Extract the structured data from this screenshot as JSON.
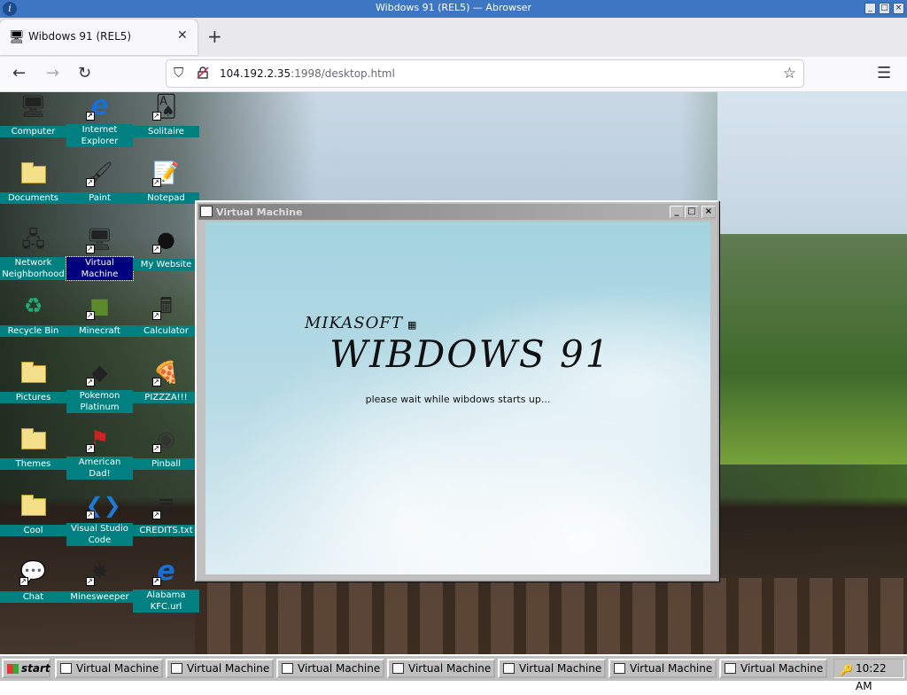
{
  "browser": {
    "window_title": "Wibdows 91 (REL5) — Abrowser",
    "tab_title": "Wibdows 91 (REL5)",
    "url_host": "104.192.2.35",
    "url_rest": ":1998/desktop.html",
    "icons": [
      "back-icon",
      "forward-icon",
      "reload-icon",
      "shield-icon",
      "lock-icon",
      "star-icon",
      "menu-icon"
    ]
  },
  "desktop": {
    "icons": [
      {
        "label": "Computer",
        "icon": "computer-icon"
      },
      {
        "label": "Internet Explorer",
        "icon": "internet-explorer-icon"
      },
      {
        "label": "Solitaire",
        "icon": "solitaire-icon"
      },
      {
        "label": "Documents",
        "icon": "folder-icon"
      },
      {
        "label": "Paint",
        "icon": "paint-icon"
      },
      {
        "label": "Notepad",
        "icon": "notepad-icon"
      },
      {
        "label": "Network Neighborhood",
        "icon": "network-icon"
      },
      {
        "label": "Virtual Machine",
        "icon": "computer-icon"
      },
      {
        "label": "My Website",
        "icon": "github-icon"
      },
      {
        "label": "Recycle Bin",
        "icon": "recycle-bin-icon"
      },
      {
        "label": "Minecraft",
        "icon": "minecraft-icon"
      },
      {
        "label": "Calculator",
        "icon": "calculator-icon"
      },
      {
        "label": "Pictures",
        "icon": "folder-icon"
      },
      {
        "label": "Pokemon Platinum",
        "icon": "pokemon-icon"
      },
      {
        "label": "PIZZZA!!!",
        "icon": "pizza-icon"
      },
      {
        "label": "Themes",
        "icon": "folder-icon"
      },
      {
        "label": "American Dad!",
        "icon": "flag-icon"
      },
      {
        "label": "Pinball",
        "icon": "pinball-icon"
      },
      {
        "label": "Cool",
        "icon": "folder-icon"
      },
      {
        "label": "Visual Studio Code",
        "icon": "vscode-icon"
      },
      {
        "label": "CREDITS.txt",
        "icon": "text-file-icon"
      },
      {
        "label": "Chat",
        "icon": "chat-icon"
      },
      {
        "label": "Minesweeper",
        "icon": "minesweeper-icon"
      },
      {
        "label": "Alabama KFC.url",
        "icon": "url-file-icon"
      }
    ]
  },
  "vm_window": {
    "title": "Virtual Machine",
    "brand": "MIKASOFT",
    "product": "WIBDOWS 91",
    "status": "please wait while wibdows starts up..."
  },
  "taskbar": {
    "start_label": "start",
    "tasks": [
      "Virtual Machine",
      "Virtual Machine",
      "Virtual Machine",
      "Virtual Machine",
      "Virtual Machine",
      "Virtual Machine",
      "Virtual Machine"
    ],
    "clock": "10:22 AM"
  }
}
